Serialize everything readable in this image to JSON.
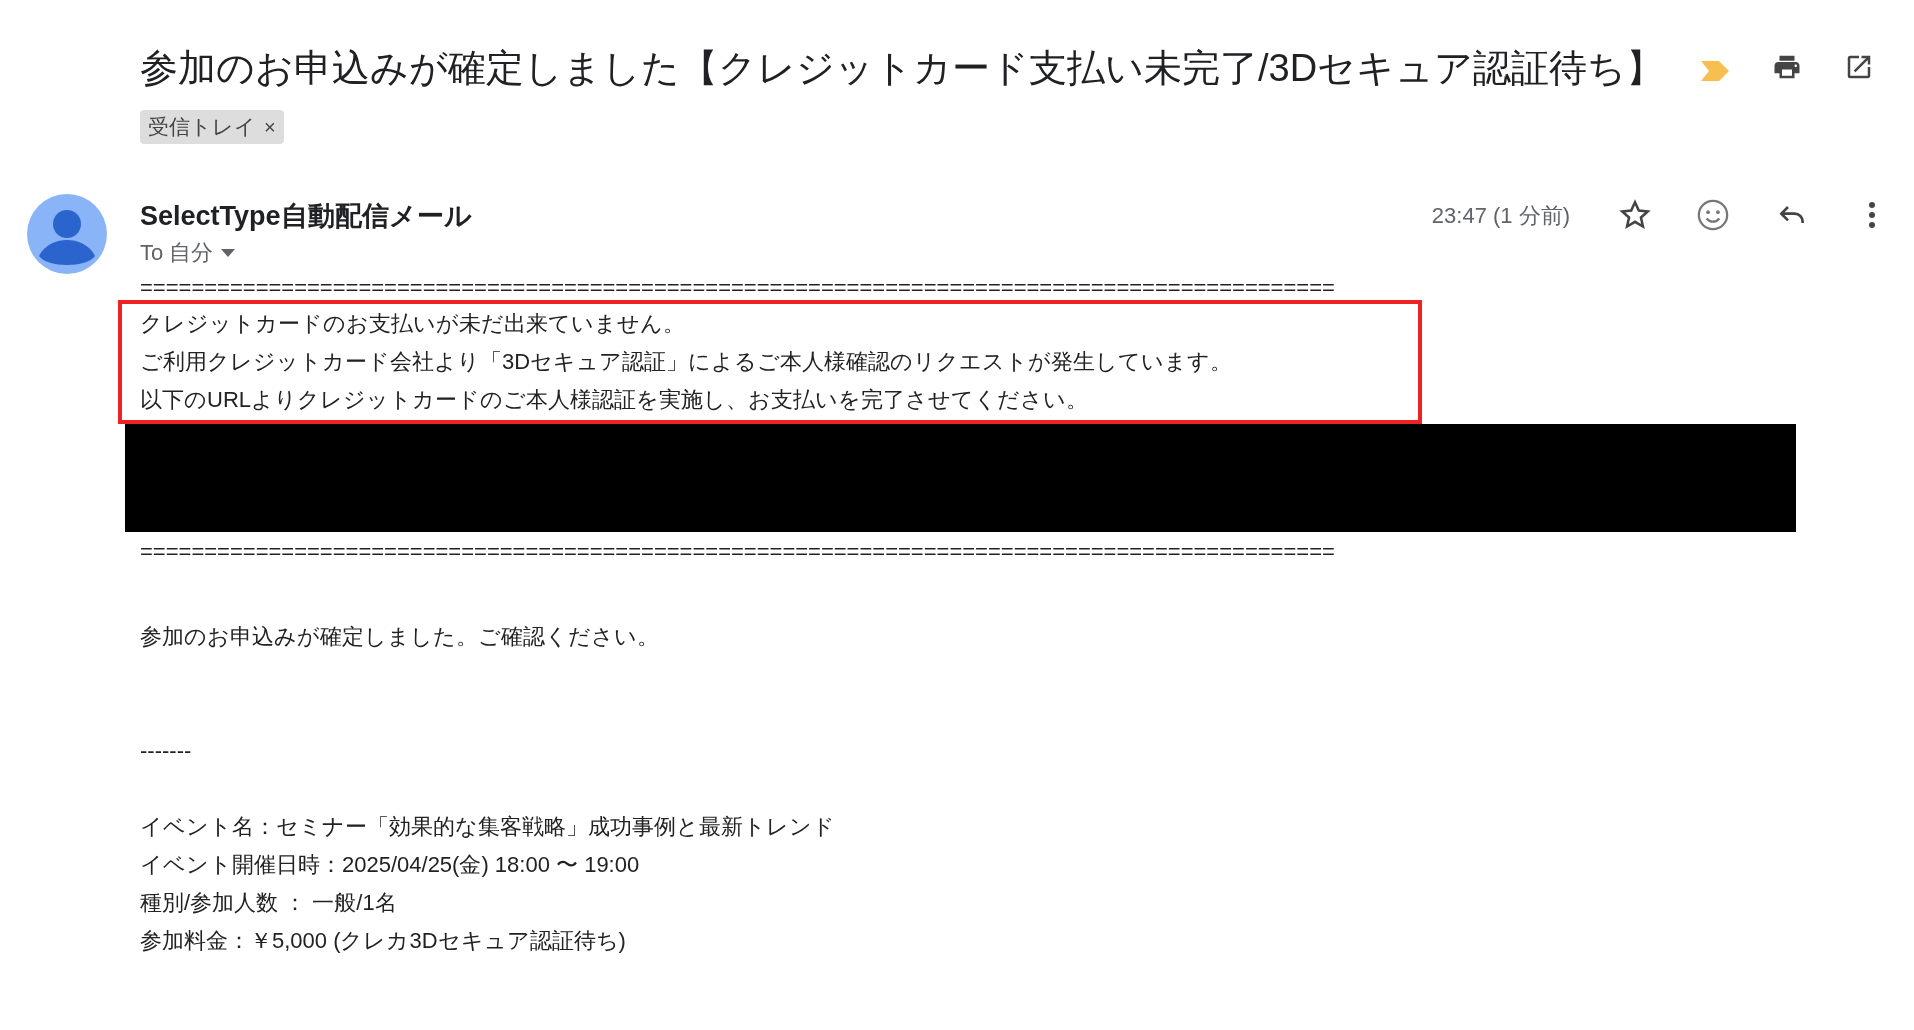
{
  "subject": {
    "title": "参加のお申込みが確定しました【クレジットカード支払い未完了/3Dセキュア認証待ち】",
    "important": true,
    "label": {
      "text": "受信トレイ",
      "remove": "×"
    }
  },
  "message": {
    "sender": "SelectType自動配信メール",
    "recipient": "To 自分",
    "time": "23:47 (1 分前)",
    "starred": false
  },
  "body": {
    "separator_top": "=============================================================================================",
    "notice_lines": [
      "クレジットカードのお支払いが未だ出来ていません。",
      "ご利用クレジットカード会社より「3Dセキュア認証」によるご本人様確認のリクエストが発生しています。",
      "以下のURLよりクレジットカードのご本人様認証を実施し、お支払いを完了させてください。"
    ],
    "separator_bottom": "=============================================================================================",
    "confirmation": "参加のお申込みが確定しました。ご確認ください。",
    "divider": "-------",
    "details": [
      "イベント名：セミナー「効果的な集客戦略」成功事例と最新トレンド",
      "イベント開催日時：2025/04/25(金) 18:00 〜 19:00",
      "種別/参加人数 ： 一般/1名",
      "参加料金：￥5,000 (クレカ3Dセキュア認証待ち)"
    ]
  }
}
